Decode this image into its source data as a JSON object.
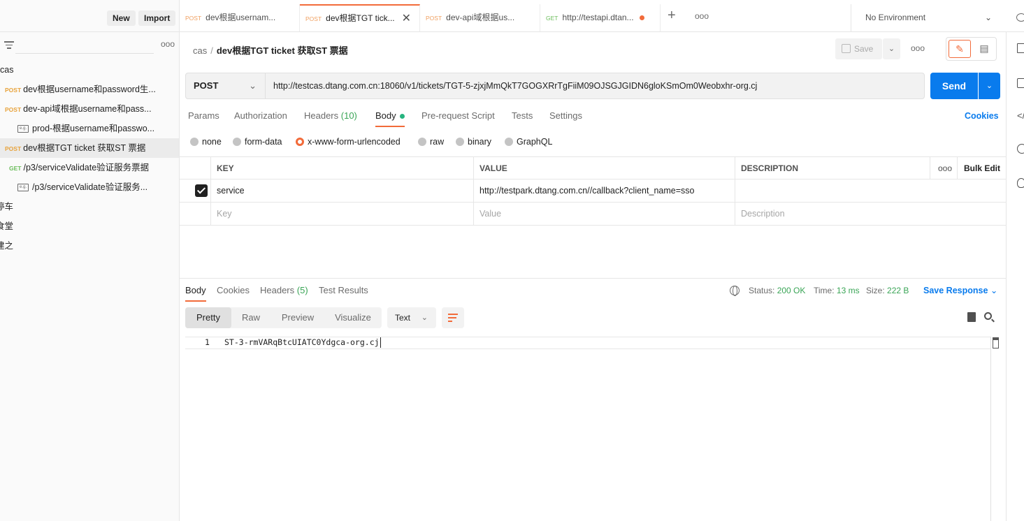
{
  "sidebar": {
    "new_label": "New",
    "import_label": "Import",
    "more": "ooo",
    "items": [
      {
        "method": "",
        "label": "cas"
      },
      {
        "method": "POST",
        "label": "dev根据username和password生..."
      },
      {
        "method": "POST",
        "label": "dev-api域根据username和pass..."
      },
      {
        "method": "",
        "label": "prod-根据username和passwo...",
        "icon": "e.g."
      },
      {
        "method": "POST",
        "label": "dev根据TGT ticket 获取ST 票据"
      },
      {
        "method": "GET",
        "label": "/p3/serviceValidate验证服务票据"
      },
      {
        "method": "",
        "label": "/p3/serviceValidate验证服务...",
        "icon": "e.g."
      },
      {
        "method": "",
        "label": "停车"
      },
      {
        "method": "",
        "label": "食堂"
      },
      {
        "method": "",
        "label": "建之"
      }
    ]
  },
  "tabs": [
    {
      "method": "POST",
      "label": "dev根据usernam..."
    },
    {
      "method": "POST",
      "label": "dev根据TGT tick..."
    },
    {
      "method": "POST",
      "label": "dev-api域根据us..."
    },
    {
      "method": "GET",
      "label": "http://testapi.dtan..."
    }
  ],
  "tab_more": "ooo",
  "environment": "No Environment",
  "breadcrumb": {
    "collection": "cas",
    "separator": "/",
    "request": "dev根据TGT ticket 获取ST 票据"
  },
  "save_label": "Save",
  "top_more": "ooo",
  "request": {
    "method": "POST",
    "url": "http://testcas.dtang.com.cn:18060/v1/tickets/TGT-5-zjxjMmQkT7GOGXRrTgFiiM09OJSGJGIDN6gloKSmOm0Weobxhr-org.cj",
    "send_label": "Send"
  },
  "req_tabs": {
    "params": "Params",
    "auth": "Authorization",
    "headers": "Headers",
    "headers_count": "(10)",
    "body": "Body",
    "prerequest": "Pre-request Script",
    "tests": "Tests",
    "settings": "Settings",
    "cookies": "Cookies"
  },
  "body_types": [
    "none",
    "form-data",
    "x-www-form-urlencoded",
    "raw",
    "binary",
    "GraphQL"
  ],
  "body_type_selected": "x-www-form-urlencoded",
  "params_table": {
    "headers": {
      "key": "KEY",
      "value": "VALUE",
      "description": "DESCRIPTION",
      "more": "ooo",
      "bulk_edit": "Bulk Edit"
    },
    "rows": [
      {
        "checked": true,
        "key": "service",
        "value": "http://testpark.dtang.com.cn//callback?client_name=sso",
        "description": ""
      }
    ],
    "placeholders": {
      "key": "Key",
      "value": "Value",
      "description": "Description"
    }
  },
  "response": {
    "tabs": {
      "body": "Body",
      "cookies": "Cookies",
      "headers": "Headers",
      "headers_count": "(5)",
      "tests": "Test Results"
    },
    "status_label": "Status:",
    "status": "200 OK",
    "time_label": "Time:",
    "time": "13 ms",
    "size_label": "Size:",
    "size": "222 B",
    "save_label": "Save Response",
    "views": [
      "Pretty",
      "Raw",
      "Preview",
      "Visualize"
    ],
    "format": "Text",
    "line_number": "1",
    "content": "ST-3-rmVARqBtcUIATC0Ydgca-org.cj"
  },
  "colors": {
    "accent": "#f26b3a",
    "send": "#097bed",
    "success": "#3aa556",
    "post": "#e8a33c",
    "get": "#6bbd5b"
  }
}
